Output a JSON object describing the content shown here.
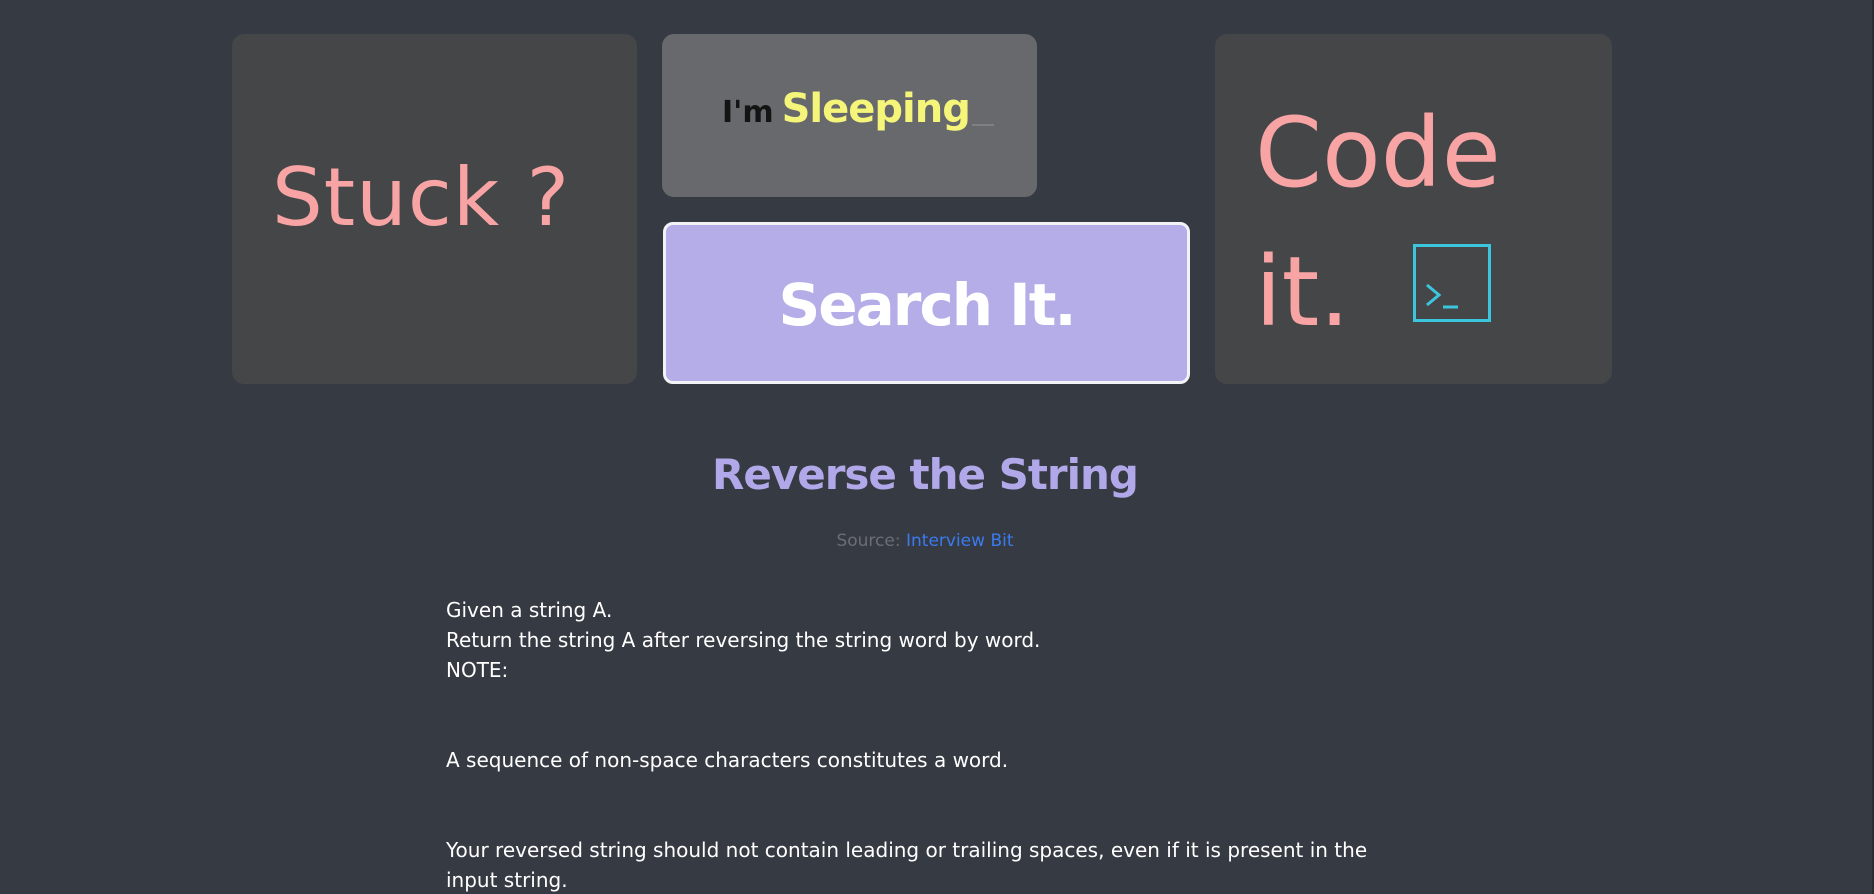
{
  "cards": {
    "stuck": {
      "text": "Stuck ?"
    },
    "sleeping": {
      "prefix": "I'm",
      "word": "Sleeping"
    },
    "search": {
      "label": "Search It."
    },
    "code": {
      "line1": "Code",
      "line2": "it.",
      "icon": "terminal-icon"
    }
  },
  "problem": {
    "title": "Reverse the String",
    "source_prefix": "Source:",
    "source_link": "Interview Bit",
    "lines": [
      "Given a string A.",
      "Return the string A after reversing the string word by word.",
      "NOTE:",
      "A sequence of non-space characters constitutes a word.",
      "Your reversed string should not contain leading or trailing spaces, even if it is present in the input string."
    ]
  },
  "colors": {
    "background": "#363a42",
    "card": "#444648",
    "accent_pink": "#f8a4a4",
    "accent_purple": "#b5ade7",
    "highlight_yellow": "#f5f57a",
    "terminal_cyan": "#3cc6de",
    "link_blue": "#3a7bf0"
  }
}
